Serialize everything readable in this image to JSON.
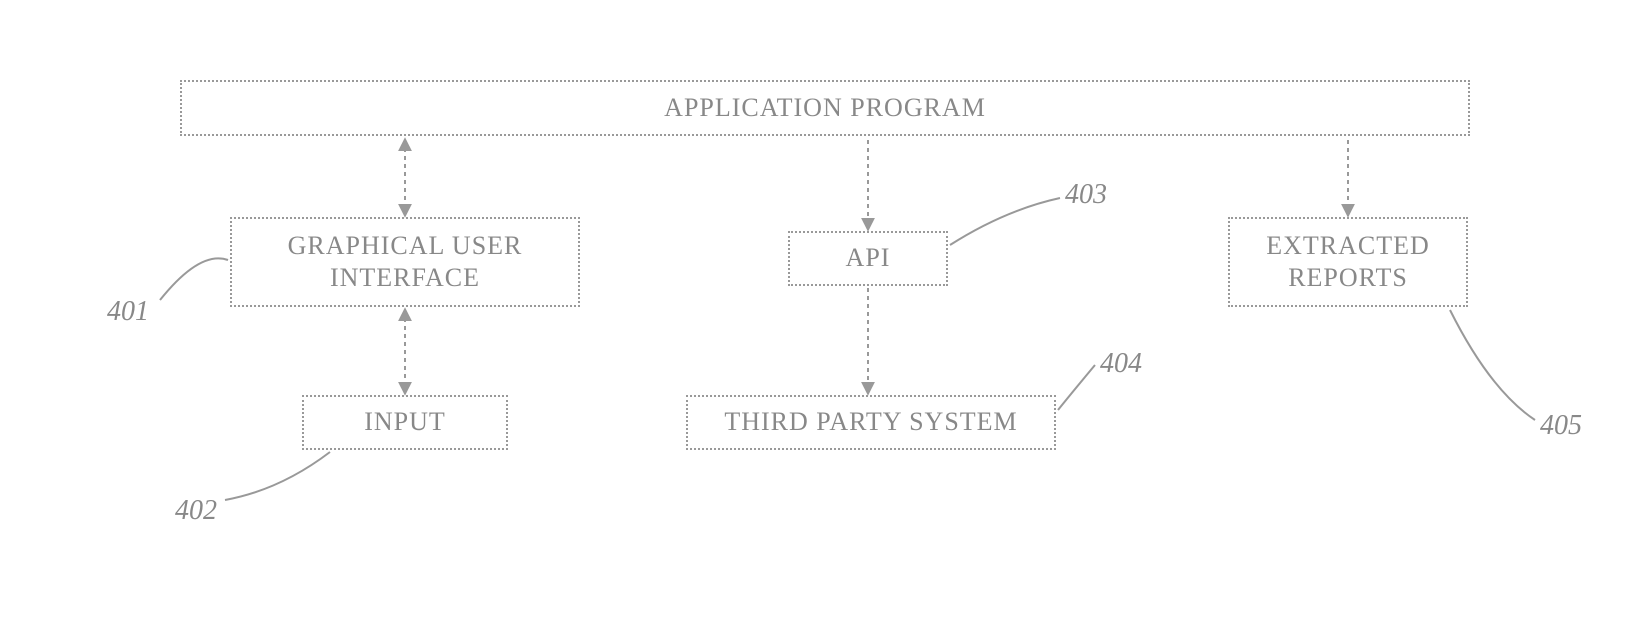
{
  "diagram": {
    "boxes": {
      "app": "APPLICATION PROGRAM",
      "gui": "GRAPHICAL USER INTERFACE",
      "input": "INPUT",
      "api": "API",
      "third_party": "THIRD PARTY SYSTEM",
      "reports": "EXTRACTED REPORTS"
    },
    "labels": {
      "gui": "401",
      "input": "402",
      "api": "403",
      "third_party": "404",
      "reports": "405"
    }
  }
}
